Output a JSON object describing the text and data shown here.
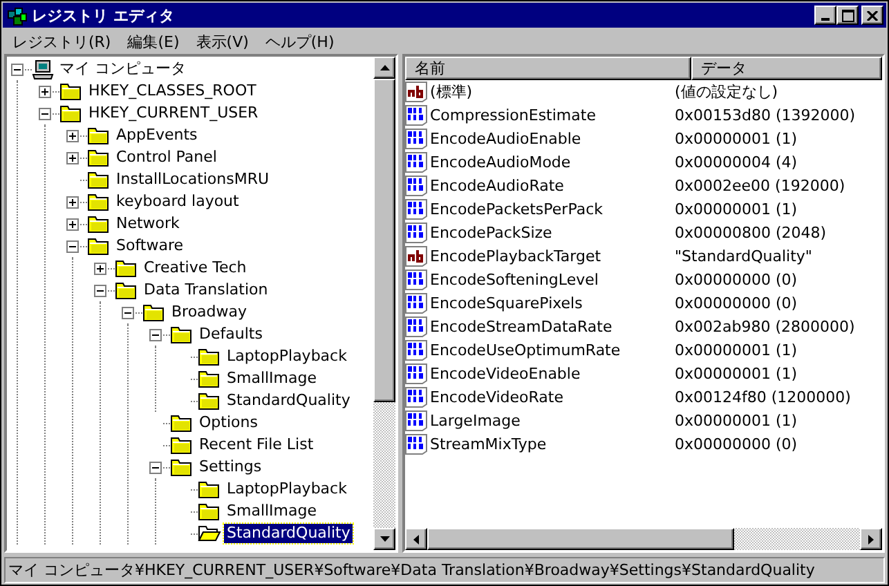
{
  "window": {
    "title": "レジストリ エディタ"
  },
  "menu": [
    "レジストリ(R)",
    "編集(E)",
    "表示(V)",
    "ヘルプ(H)"
  ],
  "tree": [
    {
      "label": "マイ コンピュータ",
      "kind": "computer",
      "expanded": true,
      "selected": false,
      "children": [
        {
          "label": "HKEY_CLASSES_ROOT",
          "kind": "folder",
          "expanded": false,
          "selected": false
        },
        {
          "label": "HKEY_CURRENT_USER",
          "kind": "folder",
          "expanded": true,
          "selected": false,
          "children": [
            {
              "label": "AppEvents",
              "kind": "folder",
              "expanded": false,
              "selected": false
            },
            {
              "label": "Control Panel",
              "kind": "folder",
              "expanded": false,
              "selected": false
            },
            {
              "label": "InstallLocationsMRU",
              "kind": "folder",
              "selected": false
            },
            {
              "label": "keyboard layout",
              "kind": "folder",
              "expanded": false,
              "selected": false
            },
            {
              "label": "Network",
              "kind": "folder",
              "expanded": false,
              "selected": false
            },
            {
              "label": "Software",
              "kind": "folder",
              "expanded": true,
              "selected": false,
              "children": [
                {
                  "label": "Creative Tech",
                  "kind": "folder",
                  "expanded": false,
                  "selected": false
                },
                {
                  "label": "Data Translation",
                  "kind": "folder",
                  "expanded": true,
                  "selected": false,
                  "children": [
                    {
                      "label": "Broadway",
                      "kind": "folder",
                      "expanded": true,
                      "selected": false,
                      "children": [
                        {
                          "label": "Defaults",
                          "kind": "folder",
                          "expanded": true,
                          "selected": false,
                          "children": [
                            {
                              "label": "LaptopPlayback",
                              "kind": "folder",
                              "selected": false
                            },
                            {
                              "label": "SmallImage",
                              "kind": "folder",
                              "selected": false
                            },
                            {
                              "label": "StandardQuality",
                              "kind": "folder",
                              "selected": false
                            }
                          ]
                        },
                        {
                          "label": "Options",
                          "kind": "folder",
                          "selected": false
                        },
                        {
                          "label": "Recent File List",
                          "kind": "folder",
                          "selected": false
                        },
                        {
                          "label": "Settings",
                          "kind": "folder",
                          "expanded": true,
                          "selected": false,
                          "children": [
                            {
                              "label": "LaptopPlayback",
                              "kind": "folder",
                              "selected": false
                            },
                            {
                              "label": "SmallImage",
                              "kind": "folder",
                              "selected": false
                            },
                            {
                              "label": "StandardQuality",
                              "kind": "folder",
                              "selected": true
                            }
                          ]
                        }
                      ]
                    }
                  ]
                }
              ]
            }
          ]
        }
      ]
    }
  ],
  "values": {
    "columns": [
      "名前",
      "データ"
    ],
    "rows": [
      {
        "kind": "string",
        "name": "(標準)",
        "data": "(値の設定なし)"
      },
      {
        "kind": "dword",
        "name": "CompressionEstimate",
        "data": "0x00153d80 (1392000)"
      },
      {
        "kind": "dword",
        "name": "EncodeAudioEnable",
        "data": "0x00000001 (1)"
      },
      {
        "kind": "dword",
        "name": "EncodeAudioMode",
        "data": "0x00000004 (4)"
      },
      {
        "kind": "dword",
        "name": "EncodeAudioRate",
        "data": "0x0002ee00 (192000)"
      },
      {
        "kind": "dword",
        "name": "EncodePacketsPerPack",
        "data": "0x00000001 (1)"
      },
      {
        "kind": "dword",
        "name": "EncodePackSize",
        "data": "0x00000800 (2048)"
      },
      {
        "kind": "string",
        "name": "EncodePlaybackTarget",
        "data": "\"StandardQuality\""
      },
      {
        "kind": "dword",
        "name": "EncodeSofteningLevel",
        "data": "0x00000000 (0)"
      },
      {
        "kind": "dword",
        "name": "EncodeSquarePixels",
        "data": "0x00000000 (0)"
      },
      {
        "kind": "dword",
        "name": "EncodeStreamDataRate",
        "data": "0x002ab980 (2800000)"
      },
      {
        "kind": "dword",
        "name": "EncodeUseOptimumRate",
        "data": "0x00000001 (1)"
      },
      {
        "kind": "dword",
        "name": "EncodeVideoEnable",
        "data": "0x00000001 (1)"
      },
      {
        "kind": "dword",
        "name": "EncodeVideoRate",
        "data": "0x00124f80 (1200000)"
      },
      {
        "kind": "dword",
        "name": "LargeImage",
        "data": "0x00000001 (1)"
      },
      {
        "kind": "dword",
        "name": "StreamMixType",
        "data": "0x00000000 (0)"
      }
    ]
  },
  "status_bar": "マイ コンピュータ¥HKEY_CURRENT_USER¥Software¥Data Translation¥Broadway¥Settings¥StandardQuality"
}
